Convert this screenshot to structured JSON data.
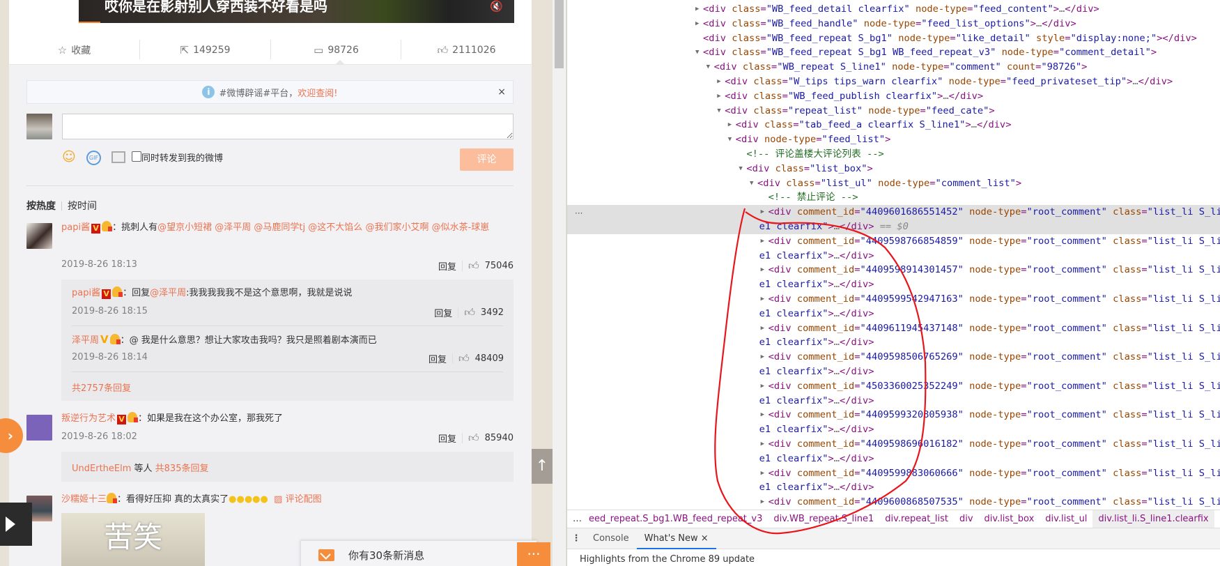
{
  "page": {
    "video": {
      "caption": "哎你是在影射别人穿西装不好看是吗"
    },
    "actions": [
      {
        "icon": "star-icon",
        "label": "收藏"
      },
      {
        "icon": "share-icon",
        "label": "149259"
      },
      {
        "icon": "comment-icon",
        "label": "98726"
      },
      {
        "icon": "thumbs-up-icon",
        "label": "2111026"
      }
    ],
    "tip": {
      "text": "#微博辟谣#平台，",
      "link": "欢迎查阅!",
      "close": "×"
    },
    "composer": {
      "placeholder": "",
      "value": "",
      "checkbox_label": "同时转发到我的微博",
      "submit": "评论",
      "gif": "GIF"
    },
    "sort_tabs": [
      "按热度",
      "按时间"
    ],
    "comments": [
      {
        "user": "papi酱",
        "text": "：挑刺人有",
        "mentions": [
          "@望京小短裙",
          "@泽平周",
          "@马鹿同学tj",
          "@这不大馅么",
          "@我们家小艾啊",
          "@似水茶-球崽"
        ],
        "time": "2019-8-26 18:13",
        "reply": "回复",
        "likes": "75046",
        "replies": [
          {
            "user": "papi酱",
            "prefix": "：回复",
            "mention": "@泽平周",
            "text": ":我我我我我不是这个意思啊，我就是说说",
            "time": "2019-8-26 18:15",
            "reply": "回复",
            "likes": "3492"
          },
          {
            "user": "泽平周",
            "prefix": "：",
            "mention": "",
            "text": "@ 我是什么意思？想让大家攻击我吗？我只是照着剧本演而已",
            "time": "2019-8-26 18:14",
            "reply": "回复",
            "likes": "48409"
          }
        ],
        "more": "共2757条回复"
      },
      {
        "user": "叛逆行为艺术",
        "text": "：如果是我在这个办公室，那我死了",
        "time": "2019-8-26 18:02",
        "reply": "回复",
        "likes": "85940",
        "summary_user": "UndErtheElm",
        "summary_mid": " 等人 ",
        "more": "共835条回复"
      },
      {
        "user": "沙糯姬十三",
        "text": "：看得好压抑 真的太真实了",
        "image_link": "评论配图",
        "image_text": "苦笑"
      }
    ],
    "popup": {
      "text": "你有30条新消息"
    },
    "chat_icon": "···",
    "to_top": "↑"
  },
  "devtools": {
    "gutter": "···",
    "lines": [
      {
        "i": 0,
        "a": "r",
        "s": "<div class=\"WB_feed_detail clearfix\" node-type=\"feed_content\">…</div>"
      },
      {
        "i": 0,
        "a": "r",
        "s": "<div class=\"WB_feed_handle\" node-type=\"feed_list_options\">…</div>"
      },
      {
        "i": 0,
        "a": "",
        "s": "<div class=\"WB_feed_repeat S_bg1\" node-type=\"like_detail\" style=\"display:none;\"></div>"
      },
      {
        "i": 0,
        "a": "d",
        "s": "<div class=\"WB_feed_repeat S_bg1 WB_feed_repeat_v3\" node-type=\"comment_detail\">"
      },
      {
        "i": 1,
        "a": "d",
        "s": "<div class=\"WB_repeat S_line1\" node-type=\"comment\" count=\"98726\">"
      },
      {
        "i": 2,
        "a": "r",
        "s": "<div class=\"W_tips tips_warn clearfix\" node-type=\"feed_privateset_tip\">…</div>"
      },
      {
        "i": 2,
        "a": "r",
        "s": "<div class=\"WB_feed_publish clearfix\">…</div>"
      },
      {
        "i": 2,
        "a": "d",
        "s": "<div class=\"repeat_list\" node-type=\"feed_cate\">"
      },
      {
        "i": 3,
        "a": "r",
        "s": "<div class=\"tab_feed_a clearfix S_line1\">…</div>"
      },
      {
        "i": 3,
        "a": "d",
        "s": "<div node-type=\"feed_list\">"
      },
      {
        "i": 4,
        "a": "",
        "s": "<!-- 评论盖楼大评论列表 -->"
      },
      {
        "i": 4,
        "a": "d",
        "s": "<div class=\"list_box\">"
      },
      {
        "i": 5,
        "a": "d",
        "s": "<div class=\"list_ul\" node-type=\"comment_list\">"
      },
      {
        "i": 6,
        "a": "",
        "s": "<!-- 禁止评论 -->"
      }
    ],
    "root_comment_ids": [
      "4409601686551452",
      "4409598766854859",
      "4409598914301457",
      "4409599542947163",
      "4409611945437148",
      "4409598506765269",
      "4503360025352249",
      "4409599320805938",
      "4409598696016182",
      "4409599883060666",
      "4409600868507535"
    ],
    "root_comment_head": " node-type=\"root_comment\" class=\"list_li S_li",
    "root_comment_tail": "e1 clearfix\">…</div>",
    "selected_suffix": " == $0",
    "breadcrumbs": [
      "…",
      "eed_repeat.S_bg1.WB_feed_repeat_v3",
      "div.WB_repeat.S_line1",
      "div.repeat_list",
      "div",
      "div.list_box",
      "div.list_ul",
      "div.list_li.S_line1.clearfix"
    ],
    "drawer_tabs": [
      "Console",
      "What's New"
    ],
    "drawer_close": "×",
    "drawer_content": "Highlights from the Chrome 89 update"
  },
  "colors": {
    "weibo_link": "#eb7350",
    "submit_disabled": "#fbbd9c",
    "annotation": "#e8161b",
    "tag": "#881280",
    "attr": "#994500",
    "value": "#1a1aa6"
  }
}
